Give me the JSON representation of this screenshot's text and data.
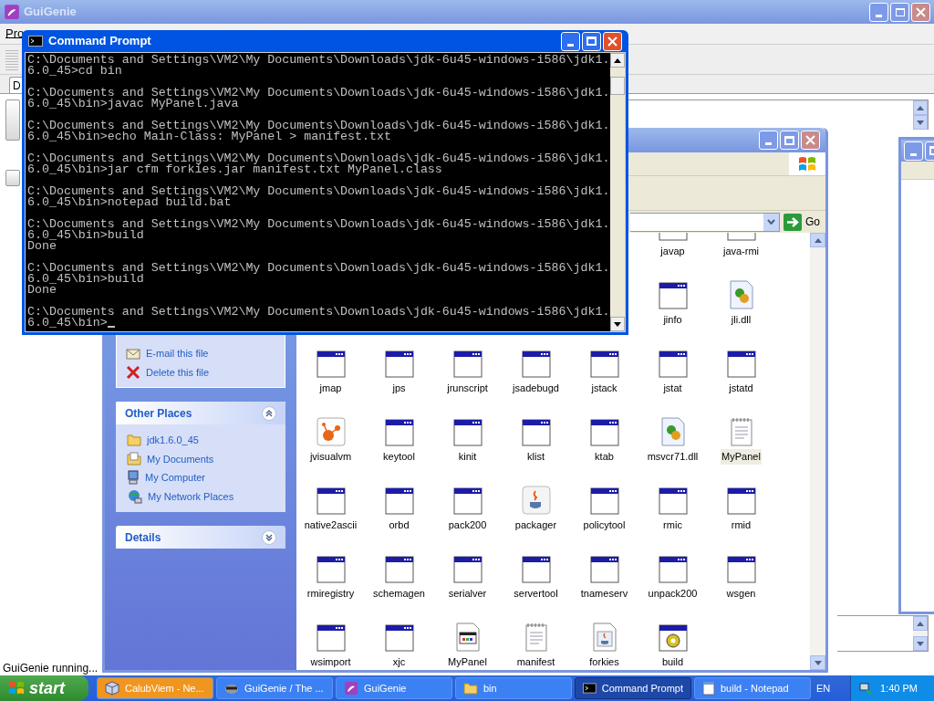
{
  "guigenie": {
    "title": "GuiGenie",
    "menu": [
      "Pro"
    ],
    "tab": "D",
    "status": "GuiGenie running..."
  },
  "explorer": {
    "go_label": "Go",
    "tasks": [
      {
        "label": "E-mail this file",
        "kind": "email"
      },
      {
        "label": "Delete this file",
        "kind": "delete"
      }
    ],
    "other_places": {
      "title": "Other Places",
      "items": [
        {
          "label": "jdk1.6.0_45",
          "kind": "folder"
        },
        {
          "label": "My Documents",
          "kind": "documents"
        },
        {
          "label": "My Computer",
          "kind": "computer"
        },
        {
          "label": "My Network Places",
          "kind": "network"
        }
      ]
    },
    "details": {
      "title": "Details"
    },
    "files": [
      {
        "name": "javap",
        "kind": "app",
        "selected": false
      },
      {
        "name": "java-rmi",
        "kind": "app",
        "selected": false
      },
      {
        "name": "jinfo",
        "kind": "app",
        "selected": false
      },
      {
        "name": "jli.dll",
        "kind": "dll",
        "selected": false
      },
      {
        "name": "jmap",
        "kind": "app",
        "selected": false
      },
      {
        "name": "jps",
        "kind": "app",
        "selected": false
      },
      {
        "name": "jrunscript",
        "kind": "app",
        "selected": false
      },
      {
        "name": "jsadebugd",
        "kind": "app",
        "selected": false
      },
      {
        "name": "jstack",
        "kind": "app",
        "selected": false
      },
      {
        "name": "jstat",
        "kind": "app",
        "selected": false
      },
      {
        "name": "jstatd",
        "kind": "app",
        "selected": false
      },
      {
        "name": "jvisualvm",
        "kind": "visualvm",
        "selected": false
      },
      {
        "name": "keytool",
        "kind": "app",
        "selected": false
      },
      {
        "name": "kinit",
        "kind": "app",
        "selected": false
      },
      {
        "name": "klist",
        "kind": "app",
        "selected": false
      },
      {
        "name": "ktab",
        "kind": "app",
        "selected": false
      },
      {
        "name": "msvcr71.dll",
        "kind": "dll",
        "selected": false
      },
      {
        "name": "MyPanel",
        "kind": "text",
        "selected": true
      },
      {
        "name": "native2ascii",
        "kind": "app",
        "selected": false
      },
      {
        "name": "orbd",
        "kind": "app",
        "selected": false
      },
      {
        "name": "pack200",
        "kind": "app",
        "selected": false
      },
      {
        "name": "packager",
        "kind": "java",
        "selected": false
      },
      {
        "name": "policytool",
        "kind": "app",
        "selected": false
      },
      {
        "name": "rmic",
        "kind": "app",
        "selected": false
      },
      {
        "name": "rmid",
        "kind": "app",
        "selected": false
      },
      {
        "name": "rmiregistry",
        "kind": "app",
        "selected": false
      },
      {
        "name": "schemagen",
        "kind": "app",
        "selected": false
      },
      {
        "name": "serialver",
        "kind": "app",
        "selected": false
      },
      {
        "name": "servertool",
        "kind": "app",
        "selected": false
      },
      {
        "name": "tnameserv",
        "kind": "app",
        "selected": false
      },
      {
        "name": "unpack200",
        "kind": "app",
        "selected": false
      },
      {
        "name": "wsgen",
        "kind": "app",
        "selected": false
      },
      {
        "name": "wsimport",
        "kind": "app",
        "selected": false
      },
      {
        "name": "xjc",
        "kind": "app",
        "selected": false
      },
      {
        "name": "MyPanel",
        "kind": "html",
        "selected": false
      },
      {
        "name": "manifest",
        "kind": "text",
        "selected": false
      },
      {
        "name": "forkies",
        "kind": "jar",
        "selected": false
      },
      {
        "name": "build",
        "kind": "batch",
        "selected": false
      }
    ]
  },
  "cmd": {
    "title": "Command Prompt",
    "blocks": [
      {
        "lines": [
          "C:\\Documents and Settings\\VM2\\My Documents\\Downloads\\jdk-6u45-windows-i586\\jdk1.",
          "6.0_45>cd bin"
        ]
      },
      {
        "lines": [
          "C:\\Documents and Settings\\VM2\\My Documents\\Downloads\\jdk-6u45-windows-i586\\jdk1.",
          "6.0_45\\bin>javac MyPanel.java"
        ]
      },
      {
        "lines": [
          "C:\\Documents and Settings\\VM2\\My Documents\\Downloads\\jdk-6u45-windows-i586\\jdk1.",
          "6.0_45\\bin>echo Main-Class: MyPanel > manifest.txt"
        ]
      },
      {
        "lines": [
          "C:\\Documents and Settings\\VM2\\My Documents\\Downloads\\jdk-6u45-windows-i586\\jdk1.",
          "6.0_45\\bin>jar cfm forkies.jar manifest.txt MyPanel.class"
        ]
      },
      {
        "lines": [
          "C:\\Documents and Settings\\VM2\\My Documents\\Downloads\\jdk-6u45-windows-i586\\jdk1.",
          "6.0_45\\bin>notepad build.bat"
        ]
      },
      {
        "lines": [
          "C:\\Documents and Settings\\VM2\\My Documents\\Downloads\\jdk-6u45-windows-i586\\jdk1.",
          "6.0_45\\bin>build",
          "Done"
        ]
      },
      {
        "lines": [
          "C:\\Documents and Settings\\VM2\\My Documents\\Downloads\\jdk-6u45-windows-i586\\jdk1.",
          "6.0_45\\bin>build",
          "Done"
        ]
      },
      {
        "lines": [
          "C:\\Documents and Settings\\VM2\\My Documents\\Downloads\\jdk-6u45-windows-i586\\jdk1.",
          "6.0_45\\bin>"
        ]
      }
    ]
  },
  "taskbar": {
    "start": "start",
    "buttons": [
      {
        "label": "CalubViem - Ne...",
        "kind": "cube",
        "selected": false,
        "flashing": true
      },
      {
        "label": "GuiGenie / The ...",
        "kind": "raccoon",
        "selected": false,
        "flashing": false
      },
      {
        "label": "GuiGenie",
        "kind": "genie",
        "selected": false,
        "flashing": false
      },
      {
        "label": "bin",
        "kind": "folder",
        "selected": false,
        "flashing": false
      },
      {
        "label": "Command Prompt",
        "kind": "console",
        "selected": true,
        "flashing": false
      },
      {
        "label": "build - Notepad",
        "kind": "notepad",
        "selected": false,
        "flashing": false
      }
    ],
    "language": "EN",
    "clock": "1:40 PM"
  }
}
